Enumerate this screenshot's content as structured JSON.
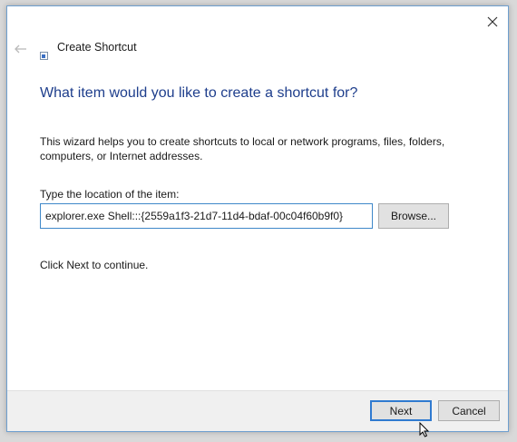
{
  "window": {
    "title": "Create Shortcut",
    "close_icon": "close-icon",
    "back_icon": "back-arrow-icon",
    "title_icon": "shortcut-icon"
  },
  "main": {
    "heading": "What item would you like to create a shortcut for?",
    "intro": "This wizard helps you to create shortcuts to local or network programs, files, folders, computers, or Internet addresses.",
    "location_label": "Type the location of the item:",
    "location_value": "explorer.exe Shell:::{2559a1f3-21d7-11d4-bdaf-00c04f60b9f0}",
    "browse_label": "Browse...",
    "continue_text": "Click Next to continue."
  },
  "footer": {
    "next_label": "Next",
    "cancel_label": "Cancel"
  },
  "colors": {
    "heading": "#1e3e8c",
    "accent_border": "#2f7ad0",
    "window_border": "#6e9fcf",
    "footer_bg": "#f0f0f0"
  }
}
